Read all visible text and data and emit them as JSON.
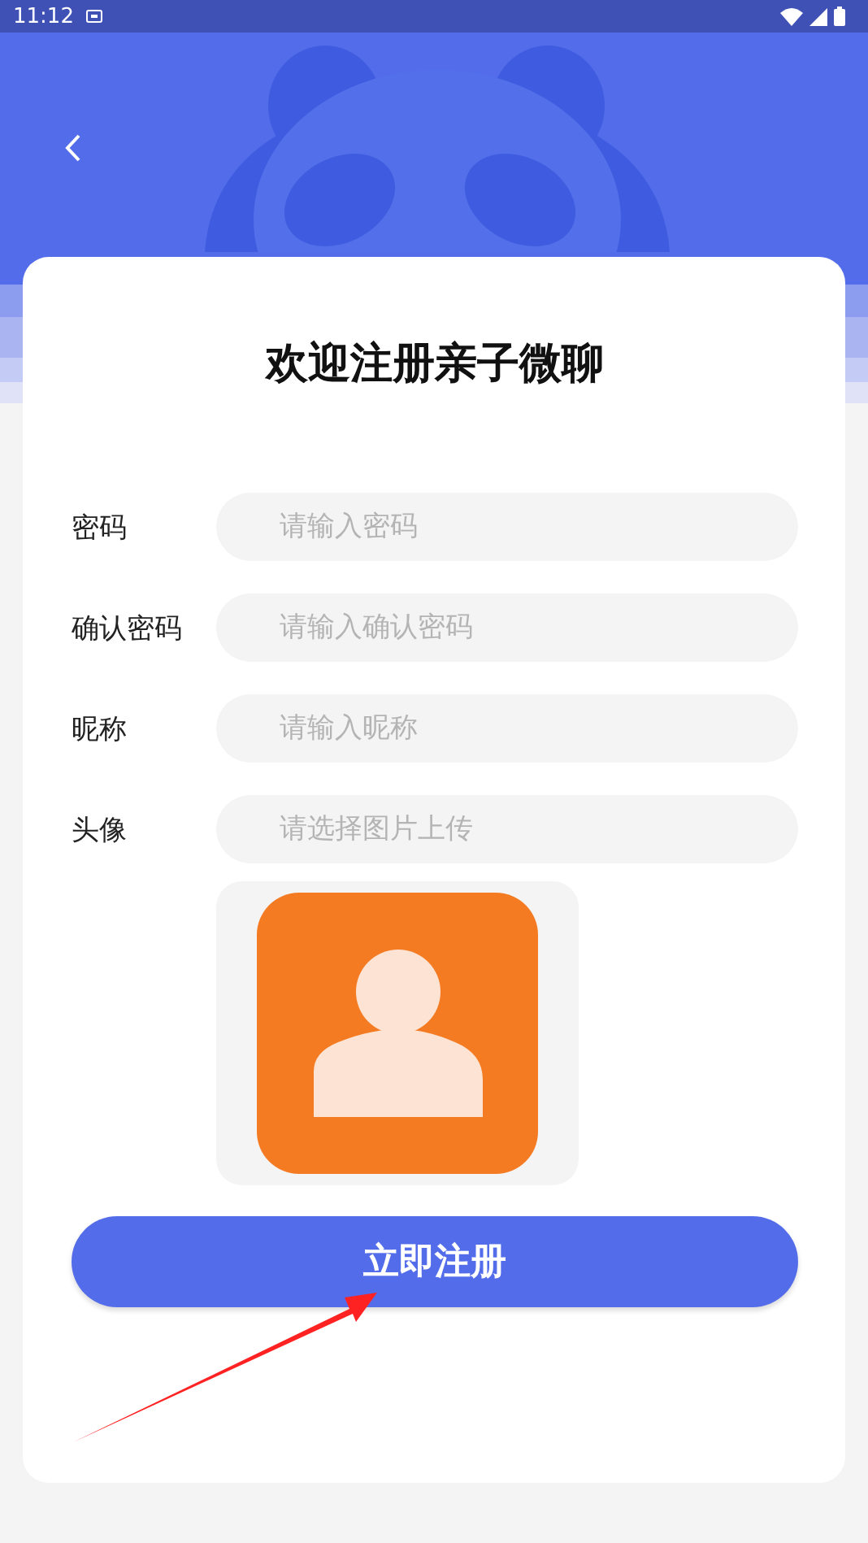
{
  "status_bar": {
    "time": "11:12"
  },
  "title": "欢迎注册亲子微聊",
  "fields": [
    {
      "label": "密码",
      "placeholder": "请输入密码"
    },
    {
      "label": "确认密码",
      "placeholder": "请输入确认密码"
    },
    {
      "label": "昵称",
      "placeholder": "请输入昵称"
    },
    {
      "label": "头像",
      "placeholder": "请选择图片上传"
    }
  ],
  "submit_button": {
    "label": "立即注册"
  }
}
